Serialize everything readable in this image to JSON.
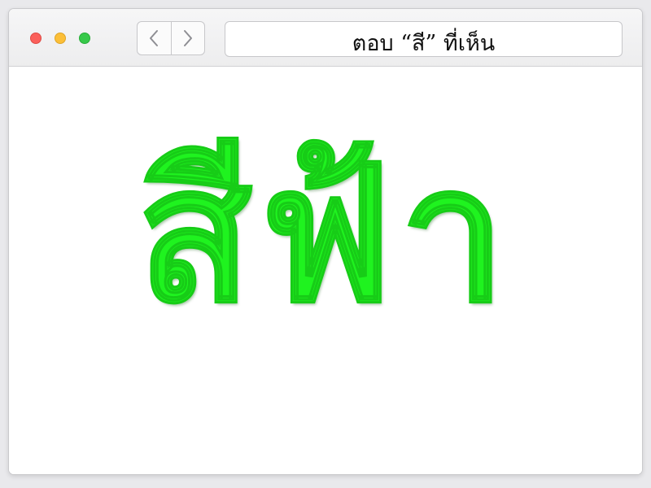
{
  "window": {
    "traffic_lights": [
      "close",
      "minimize",
      "maximize"
    ]
  },
  "toolbar": {
    "back_icon": "chevron-left-icon",
    "forward_icon": "chevron-right-icon",
    "address_text": "ตอบ “สี” ที่เห็น"
  },
  "content": {
    "word": "สีฟ้า",
    "word_color": "#1ff31f"
  }
}
